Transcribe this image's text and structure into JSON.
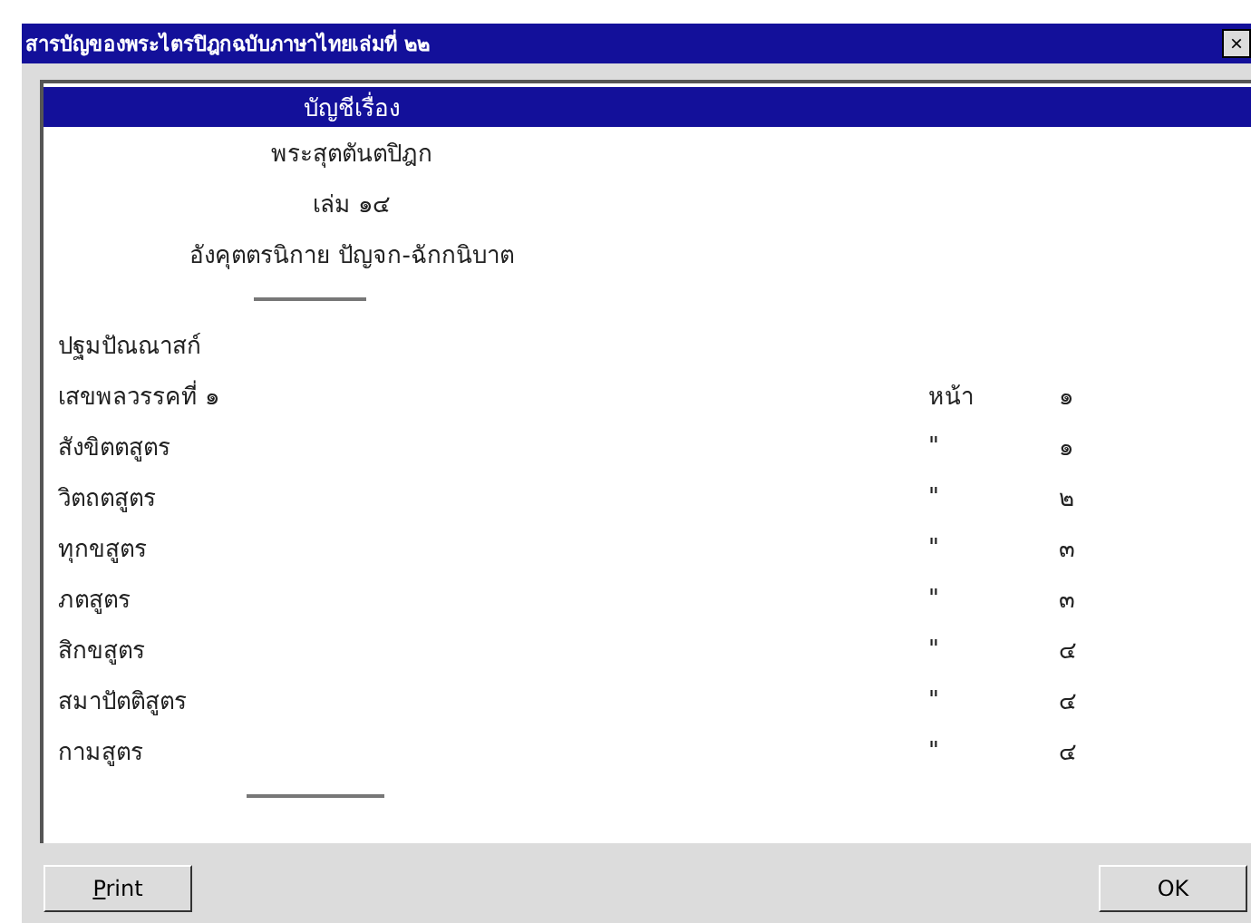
{
  "window": {
    "title": "สารบัญของพระไตรปิฎกฉบับภาษาไทยเล่มที่ ๒๒",
    "close": "×"
  },
  "lines": [
    {
      "kind": "center",
      "text": "บัญชีเรื่อง",
      "selected": true
    },
    {
      "kind": "center",
      "text": "พระสุตตันตปิฎก",
      "selected": false
    },
    {
      "kind": "center",
      "text": "เล่ม ๑๔",
      "selected": false
    },
    {
      "kind": "center",
      "text": "อังคุตตรนิกาย ปัญจก-ฉักกนิบาต",
      "selected": false
    },
    {
      "kind": "rule",
      "selected": false
    },
    {
      "kind": "entry",
      "text": "ปฐมปัณณาสก์",
      "selected": false
    },
    {
      "kind": "entry",
      "text": "เสขพลวรรคที่ ๑",
      "col_2": "หน้า",
      "col_3": "๑",
      "selected": false
    },
    {
      "kind": "entry",
      "text": "สังขิตตสูตร",
      "col_2": "\"",
      "col_3": "๑",
      "selected": false
    },
    {
      "kind": "entry",
      "text": "วิตถตสูตร",
      "col_2": "\"",
      "col_3": "๒",
      "selected": false
    },
    {
      "kind": "entry",
      "text": "ทุกขสูตร",
      "col_2": "\"",
      "col_3": "๓",
      "selected": false
    },
    {
      "kind": "entry",
      "text": "ภตสูตร",
      "col_2": "\"",
      "col_3": "๓",
      "selected": false
    },
    {
      "kind": "entry",
      "text": "สิกขสูตร",
      "col_2": "\"",
      "col_3": "๔",
      "selected": false
    },
    {
      "kind": "entry",
      "text": "สมาปัตติสูตร",
      "col_2": "\"",
      "col_3": "๔",
      "selected": false
    },
    {
      "kind": "entry",
      "text": "กามสูตร",
      "col_2": "\"",
      "col_3": "๔",
      "selected": false
    },
    {
      "kind": "rule2",
      "selected": false
    }
  ],
  "buttons": [
    {
      "label": "Print",
      "mnemonic": true
    },
    {
      "label": "OK",
      "mnemonic": false
    }
  ]
}
